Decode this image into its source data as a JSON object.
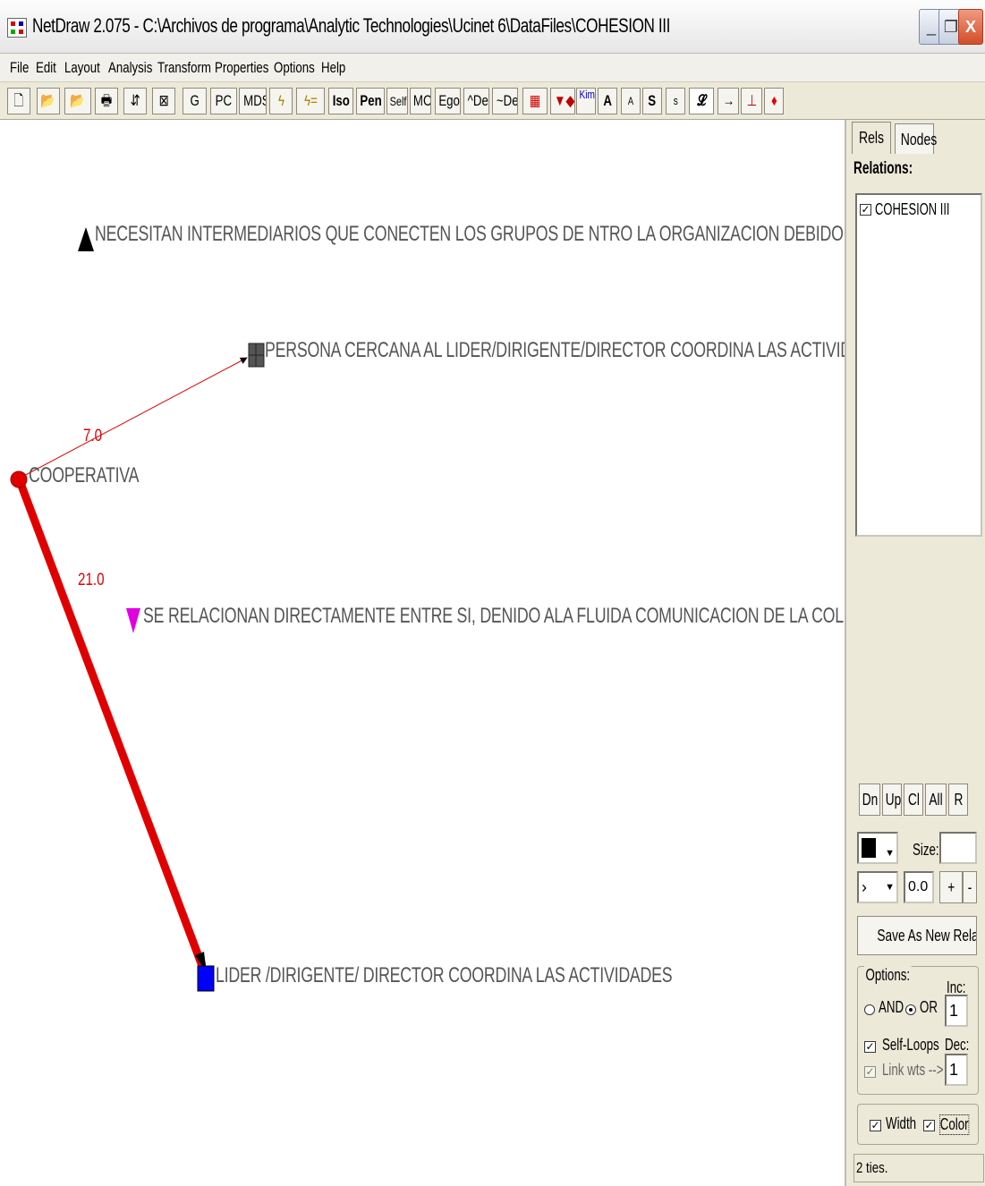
{
  "window": {
    "title": "NetDraw 2.075 - C:\\Archivos de programa\\Analytic Technologies\\Ucinet 6\\DataFiles\\COHESION III",
    "min_glyph": "_",
    "max_glyph": "❐",
    "close_glyph": "X"
  },
  "menu": [
    "File",
    "Edit",
    "Layout",
    "Analysis",
    "Transform",
    "Properties",
    "Options",
    "Help"
  ],
  "toolbar": {
    "g": "G",
    "pc": "PC",
    "mds": "MDS",
    "iso": "Iso",
    "pen": "Pen",
    "self": "Self",
    "mc": "MC",
    "ego": "Ego",
    "del1": "^Del",
    "del2": "~Del",
    "kim": "Kim",
    "a_big": "A",
    "a_small": "A",
    "s_big": "S",
    "s_small": "s"
  },
  "network": {
    "nodes": [
      {
        "id": "n1",
        "label": "NECESITAN INTERMEDIARIOS QUE CONECTEN LOS GRUPOS DE NTRO LA ORGANIZACION DEBIDO A LA DIFICULTAD",
        "shape": "triangle-up",
        "color": "#000000"
      },
      {
        "id": "n2",
        "label": "PERSONA CERCANA AL LIDER/DIRIGENTE/DIRECTOR COORDINA LAS ACTIVIDADES",
        "shape": "grid-square",
        "color": "#666666"
      },
      {
        "id": "n3",
        "label": "COOPERATIVA",
        "shape": "circle",
        "color": "#e00000"
      },
      {
        "id": "n4",
        "label": "SE RELACIONAN DIRECTAMENTE ENTRE SI, DENIDO ALA FLUIDA COMUNICACION DE LA COLECTIVIDAD.",
        "shape": "triangle-down",
        "color": "#e000e0"
      },
      {
        "id": "n5",
        "label": "LIDER /DIRIGENTE/ DIRECTOR COORDINA LAS ACTIVIDADES",
        "shape": "square",
        "color": "#0000ff"
      }
    ],
    "edges": [
      {
        "from": "n3",
        "to": "n2",
        "weight": "7.0",
        "color": "#e00000"
      },
      {
        "from": "n3",
        "to": "n5",
        "weight": "21.0",
        "color": "#e00000"
      }
    ]
  },
  "panel": {
    "tabs": [
      "Rels",
      "Nodes"
    ],
    "relations_label": "Relations:",
    "relations": [
      {
        "name": "COHESION III",
        "checked": true
      }
    ],
    "buttons": {
      "dn": "Dn",
      "up": "Up",
      "cl": "Cl",
      "all": "All",
      "r": "R"
    },
    "size_label": "Size:",
    "size_value": "",
    "shape_select": "›",
    "value_input": "0.0",
    "plus": "+",
    "minus": "-",
    "save_relation": "Save As New Relation",
    "options_label": "Options:",
    "and_label": "AND",
    "or_label": "OR",
    "inc_label": "Inc:",
    "inc_value": "1",
    "self_loops": "Self-Loops",
    "link_wts": "Link wts -->",
    "dec_label": "Dec:",
    "dec_value": "1",
    "width_label": "Width",
    "color_label": "Color",
    "status": "2 ties."
  }
}
